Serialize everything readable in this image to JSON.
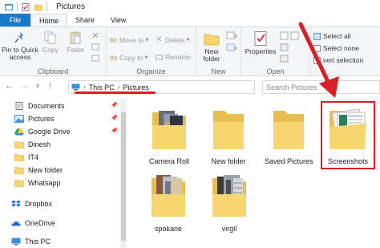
{
  "window": {
    "title": "Pictures"
  },
  "tabs": [
    {
      "label": "File"
    },
    {
      "label": "Home"
    },
    {
      "label": "Share"
    },
    {
      "label": "View"
    }
  ],
  "ribbon": {
    "clipboard": {
      "label": "Clipboard",
      "pin": "Pin to Quick\naccess",
      "copy": "Copy",
      "paste": "Paste"
    },
    "organize": {
      "label": "Organize",
      "move_to": "Move to",
      "copy_to": "Copy to",
      "delete": "Delete",
      "rename": "Rename"
    },
    "new": {
      "label": "New",
      "new_folder": "New\nfolder"
    },
    "open": {
      "label": "Open",
      "properties": "Properties"
    },
    "select": {
      "select_all": "Select all",
      "select_none": "Select none",
      "invert": "vert selection"
    }
  },
  "address": {
    "segments": [
      "This PC",
      "Pictures"
    ],
    "search_placeholder": "Search Pictures"
  },
  "sidebar": {
    "items": [
      {
        "label": "Documents",
        "icon": "documents-icon",
        "pinned": true
      },
      {
        "label": "Pictures",
        "icon": "pictures-icon",
        "pinned": true
      },
      {
        "label": "Google Drive",
        "icon": "google-drive-icon",
        "pinned": true
      },
      {
        "label": "Dinesh",
        "icon": "folder-icon",
        "pinned": false
      },
      {
        "label": "IT4",
        "icon": "folder-icon",
        "pinned": false
      },
      {
        "label": "New folder",
        "icon": "folder-icon",
        "pinned": false
      },
      {
        "label": "Whatsapp",
        "icon": "folder-icon",
        "pinned": false
      },
      {
        "label": "Dropbox",
        "icon": "dropbox-icon",
        "pinned": false
      },
      {
        "label": "OneDrive",
        "icon": "onedrive-icon",
        "pinned": false
      },
      {
        "label": "This PC",
        "icon": "this-pc-icon",
        "pinned": false
      }
    ]
  },
  "folders": [
    {
      "label": "Camera Roll",
      "kind": "photos"
    },
    {
      "label": "New folder",
      "kind": "empty"
    },
    {
      "label": "Saved Pictures",
      "kind": "empty"
    },
    {
      "label": "Screenshots",
      "kind": "screens",
      "highlighted": true
    },
    {
      "label": "spokane",
      "kind": "photos"
    },
    {
      "label": "virgil",
      "kind": "photos"
    }
  ],
  "colors": {
    "accent": "#1979ca",
    "highlight": "#d82027",
    "folder": "#f7d56f"
  }
}
